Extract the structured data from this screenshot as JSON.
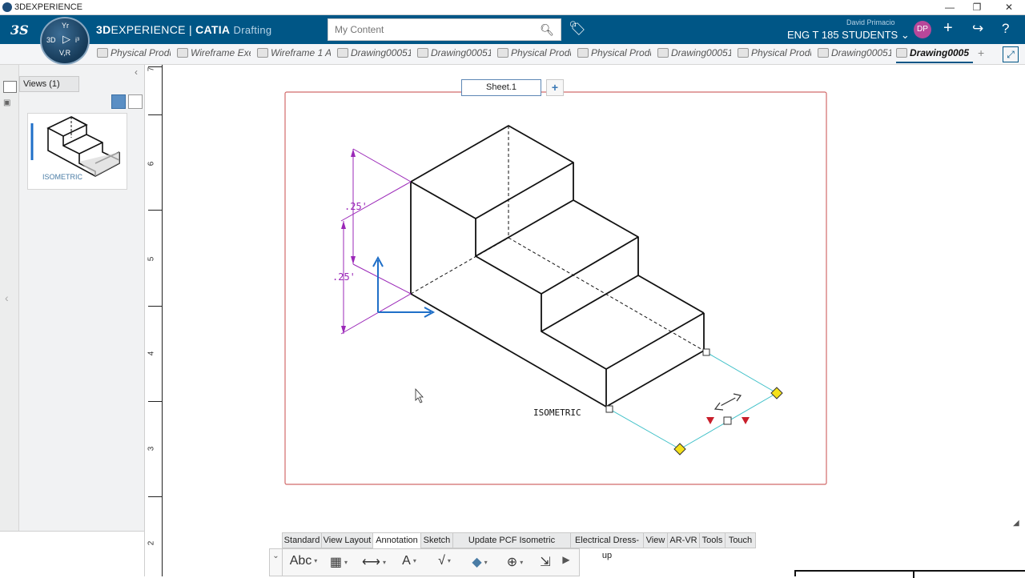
{
  "window": {
    "title": "3DEXPERIENCE"
  },
  "topbar": {
    "brand_bold": "3D",
    "brand_rest": "EXPERIENCE | ",
    "brand_catia": "CATIA",
    "app_name": "Drafting",
    "search_placeholder": "My Content",
    "user_name": "David Primacio",
    "tenant": "ENG T 185 STUDENTS",
    "avatar": "DP",
    "compass": {
      "top": "Yr",
      "left": "3D",
      "right": "i³",
      "bottom": "V,R"
    }
  },
  "tabs": [
    {
      "label": "Physical Produ",
      "active": false
    },
    {
      "label": "Wireframe Exe",
      "active": false
    },
    {
      "label": "Wireframe 1 A",
      "active": false
    },
    {
      "label": "Drawing00051",
      "active": false
    },
    {
      "label": "Drawing00051",
      "active": false
    },
    {
      "label": "Physical Produ",
      "active": false
    },
    {
      "label": "Physical Produ",
      "active": false
    },
    {
      "label": "Drawing00051",
      "active": false
    },
    {
      "label": "Physical Produ",
      "active": false
    },
    {
      "label": "Drawing00051",
      "active": false
    },
    {
      "label": "Drawing0005",
      "active": true
    }
  ],
  "views_panel": {
    "tab_label": "Views (1)",
    "thumbnail_label": "ISOMETRIC"
  },
  "ruler": {
    "numbers": [
      "7",
      "6",
      "5",
      "4",
      "3",
      "2"
    ]
  },
  "sheet": {
    "tab_label": "Sheet.1",
    "add_label": "+",
    "view_label": "ISOMETRIC",
    "dimensions": [
      ".25'",
      ".25'"
    ]
  },
  "command_tabs": [
    "Standard",
    "View Layout",
    "Annotation",
    "Sketch",
    "Update PCF Isometric Drawing",
    "Electrical Dress-up",
    "View",
    "AR-VR",
    "Tools",
    "Touch"
  ],
  "active_command_tab": "Annotation",
  "commands": [
    {
      "name": "text-command",
      "label": "Abc"
    },
    {
      "name": "table-command",
      "label": "▦"
    },
    {
      "name": "dimension-command",
      "label": "⟷"
    },
    {
      "name": "text-with-leader-command",
      "label": "A"
    },
    {
      "name": "roughness-symbol-command",
      "label": "√"
    },
    {
      "name": "weld-command",
      "label": "◆"
    },
    {
      "name": "center-mark-command",
      "label": "⊕"
    },
    {
      "name": "axis-command",
      "label": "⇲"
    }
  ],
  "colors": {
    "topbar": "#005686",
    "dimension": "#9b28b8",
    "axis": "#1f6fc8",
    "selection": "#3fc0c8",
    "sheet_border": "#d16a6a"
  }
}
